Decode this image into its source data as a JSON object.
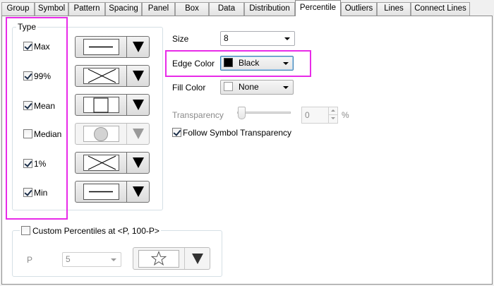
{
  "tabs": [
    {
      "label": "Group"
    },
    {
      "label": "Symbol"
    },
    {
      "label": "Pattern"
    },
    {
      "label": "Spacing"
    },
    {
      "label": "Panel"
    },
    {
      "label": "Box"
    },
    {
      "label": "Data"
    },
    {
      "label": "Distribution"
    },
    {
      "label": "Percentile",
      "active": true
    },
    {
      "label": "Outliers"
    },
    {
      "label": "Lines"
    },
    {
      "label": "Connect Lines"
    }
  ],
  "type_group": {
    "title": "Type",
    "items": [
      {
        "label": "Max",
        "checked": true,
        "symbol": "horizontal-line",
        "enabled": true
      },
      {
        "label": "99%",
        "checked": true,
        "symbol": "x-cross",
        "enabled": true
      },
      {
        "label": "Mean",
        "checked": true,
        "symbol": "square",
        "enabled": true
      },
      {
        "label": "Median",
        "checked": false,
        "symbol": "circle",
        "enabled": false
      },
      {
        "label": "1%",
        "checked": true,
        "symbol": "x-cross",
        "enabled": true
      },
      {
        "label": "Min",
        "checked": true,
        "symbol": "horizontal-line",
        "enabled": true
      }
    ]
  },
  "size": {
    "label": "Size",
    "value": "8"
  },
  "edge_color": {
    "label": "Edge Color",
    "value": "Black",
    "swatch": "#000000"
  },
  "fill_color": {
    "label": "Fill Color",
    "value": "None",
    "swatch": "#ffffff"
  },
  "transparency": {
    "label": "Transparency",
    "value": "0",
    "unit": "%",
    "level": 0
  },
  "follow_symbol_transparency": {
    "label": "Follow Symbol Transparency",
    "checked": true
  },
  "custom_percentiles": {
    "label": "Custom Percentiles at <P, 100-P>",
    "checked": false,
    "p_label": "P",
    "p_value": "5",
    "symbol": "star"
  },
  "colors": {
    "highlight": "#e82be8",
    "accent": "#3c7fb1"
  }
}
